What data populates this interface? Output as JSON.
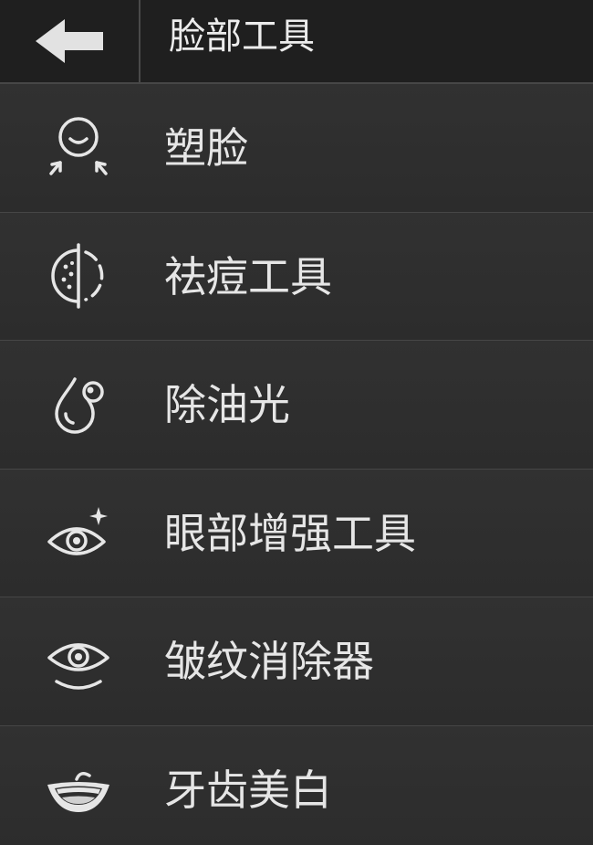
{
  "header": {
    "title": "脸部工具",
    "back_icon": "arrow-left-icon"
  },
  "menu": {
    "items": [
      {
        "label": "塑脸",
        "icon": "face-reshape-icon"
      },
      {
        "label": "祛痘工具",
        "icon": "blemish-removal-icon"
      },
      {
        "label": "除油光",
        "icon": "oil-drop-icon"
      },
      {
        "label": "眼部增强工具",
        "icon": "eye-sparkle-icon"
      },
      {
        "label": "皱纹消除器",
        "icon": "eye-wrinkle-icon"
      },
      {
        "label": "牙齿美白",
        "icon": "teeth-smile-icon"
      }
    ]
  },
  "colors": {
    "header_bg": "#1f1f1f",
    "row_bg": "#2f2f2f",
    "divider": "#464646",
    "icon": "#e6e6e6",
    "text": "#e6e6e6"
  }
}
